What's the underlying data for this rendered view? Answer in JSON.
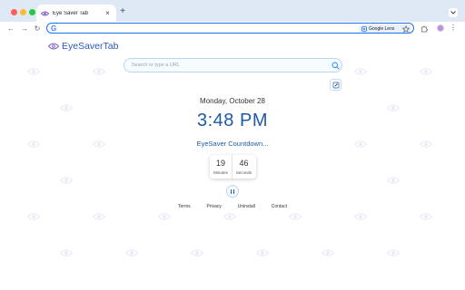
{
  "browser": {
    "tab_title": "Eye Saver Tab",
    "new_tab_symbol": "+",
    "close_symbol": "×",
    "back_symbol": "←",
    "forward_symbol": "→",
    "reload_symbol": "↻",
    "omnibox_g": "G",
    "lens_label": "Google Lens",
    "menu_symbol": "⋮",
    "accent_color": "#1a73e8",
    "tabstrip_color": "#dfe8f5"
  },
  "app": {
    "brand_name": "EyeSaverTab",
    "brand_color": "#2a58b8",
    "search_placeholder": "Search or type a URL",
    "date": "Monday, October 28",
    "time": "3:48 PM",
    "countdown_label": "EyeSaver Countdown...",
    "timer": {
      "minutes_value": "19",
      "minutes_label": "Minutes",
      "seconds_value": "46",
      "seconds_label": "Seconds"
    },
    "footer_links": [
      "Terms",
      "Privacy",
      "Uninstall",
      "Contact"
    ],
    "accent_color": "#1e5aa8"
  },
  "icons": {
    "tab_favicon": "eye-icon",
    "search": "search-icon",
    "edit": "edit-icon",
    "pause": "pause-icon",
    "watermark": "eye-watermark-icon",
    "lens": "lens-icon",
    "bookmark": "star-icon",
    "extensions": "puzzle-icon",
    "dropdown": "chevron-down-icon"
  }
}
